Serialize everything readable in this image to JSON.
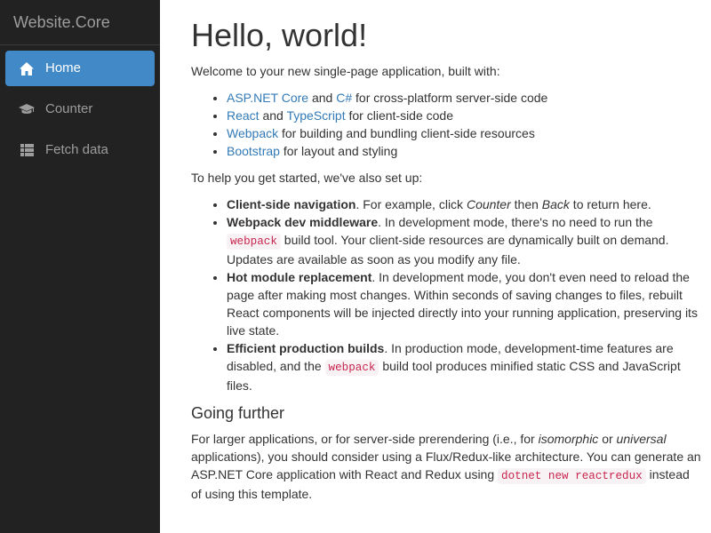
{
  "sidebar": {
    "brand": "Website.Core",
    "items": [
      {
        "label": "Home",
        "icon": "home-icon",
        "active": true
      },
      {
        "label": "Counter",
        "icon": "graduation-cap-icon",
        "active": false
      },
      {
        "label": "Fetch data",
        "icon": "list-icon",
        "active": false
      }
    ]
  },
  "main": {
    "title": "Hello, world!",
    "intro": "Welcome to your new single-page application, built with:",
    "stack": [
      {
        "links": [
          "ASP.NET Core",
          "C#"
        ],
        "joiner": " and ",
        "rest": " for cross-platform server-side code"
      },
      {
        "links": [
          "React",
          "TypeScript"
        ],
        "joiner": " and ",
        "rest": " for client-side code"
      },
      {
        "links": [
          "Webpack"
        ],
        "rest": " for building and bundling client-side resources"
      },
      {
        "links": [
          "Bootstrap"
        ],
        "rest": " for layout and styling"
      }
    ],
    "setup_intro": "To help you get started, we've also set up:",
    "features": {
      "nav_title": "Client-side navigation",
      "nav_text_1": ". For example, click ",
      "nav_em_1": "Counter",
      "nav_text_2": " then ",
      "nav_em_2": "Back",
      "nav_text_3": " to return here.",
      "webpack_title": "Webpack dev middleware",
      "webpack_text_1": ". In development mode, there's no need to run the ",
      "webpack_code": "webpack",
      "webpack_text_2": " build tool. Your client-side resources are dynamically built on demand. Updates are available as soon as you modify any file.",
      "hmr_title": "Hot module replacement",
      "hmr_text": ". In development mode, you don't even need to reload the page after making most changes. Within seconds of saving changes to files, rebuilt React components will be injected directly into your running application, preserving its live state.",
      "prod_title": "Efficient production builds",
      "prod_text_1": ". In production mode, development-time features are disabled, and the ",
      "prod_code": "webpack",
      "prod_text_2": " build tool produces minified static CSS and JavaScript files."
    },
    "further_heading": "Going further",
    "further": {
      "text_1": "For larger applications, or for server-side prerendering (i.e., for ",
      "em_1": "isomorphic",
      "text_2": " or ",
      "em_2": "universal",
      "text_3": " applications), you should consider using a Flux/Redux-like architecture. You can generate an ASP.NET Core application with React and Redux using ",
      "code": "dotnet new reactredux",
      "text_4": " instead of using this template."
    }
  },
  "colors": {
    "sidebar_bg": "#222222",
    "active_bg": "#4189c7",
    "link": "#337ab7",
    "code": "#c7254e"
  }
}
